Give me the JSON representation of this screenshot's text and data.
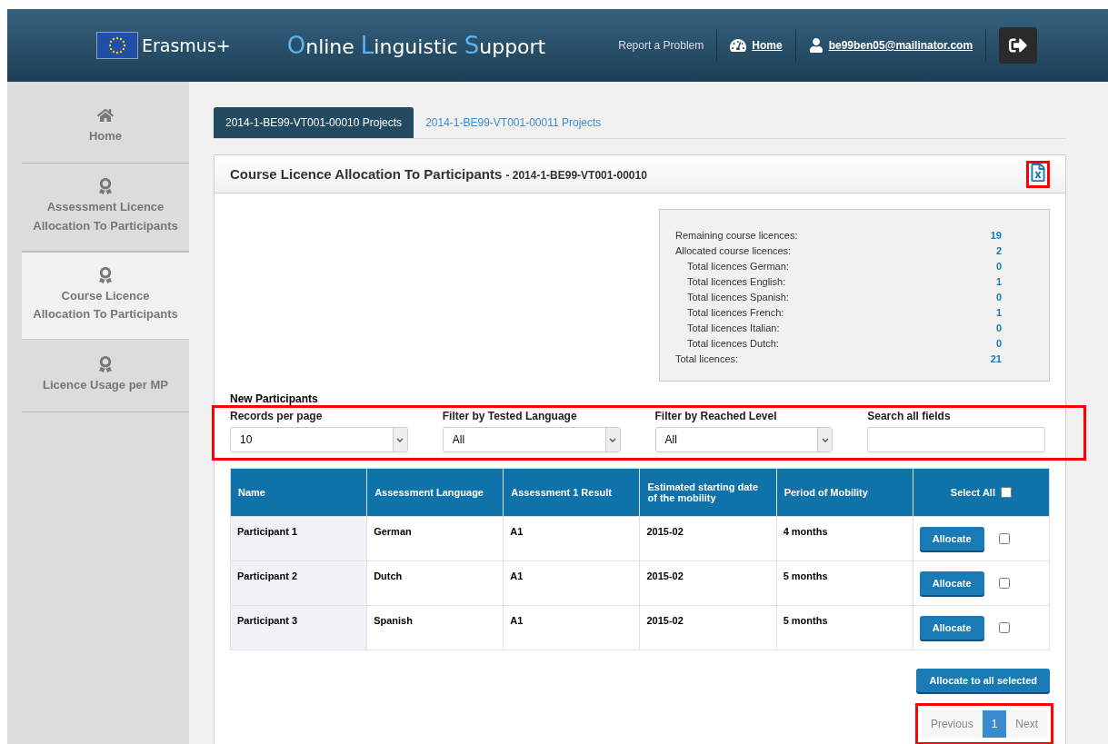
{
  "header": {
    "program": "Erasmus+",
    "title_parts": [
      {
        "text": "O",
        "accent": true
      },
      {
        "text": "nline ",
        "accent": false
      },
      {
        "text": "L",
        "accent": true
      },
      {
        "text": "inguistic ",
        "accent": false
      },
      {
        "text": "S",
        "accent": true
      },
      {
        "text": "upport",
        "accent": false
      }
    ],
    "report": "Report a Problem",
    "home": "Home",
    "user": "be99ben05@mailinator.com"
  },
  "sidebar": {
    "items": [
      {
        "label": "Home",
        "kind": "home",
        "selected": false
      },
      {
        "label": "Assessment Licence Allocation To Participants",
        "kind": "award",
        "selected": false
      },
      {
        "label": "Course Licence Allocation To Participants",
        "kind": "award",
        "selected": true
      },
      {
        "label": "Licence Usage per MP",
        "kind": "award",
        "selected": false
      }
    ]
  },
  "tabs": [
    {
      "label": "2014-1-BE99-VT001-00010 Projects",
      "selected": true
    },
    {
      "label": "2014-1-BE99-VT001-00011 Projects",
      "selected": false
    }
  ],
  "panel": {
    "title": "Course Licence Allocation To Participants",
    "subtitle": "- 2014-1-BE99-VT001-00010",
    "export_highlighted": true
  },
  "stats": [
    {
      "label": "Remaining course licences:",
      "value": "19",
      "indented": false
    },
    {
      "label": "Allocated course licences:",
      "value": "2",
      "indented": false
    },
    {
      "label": "Total licences German:",
      "value": "0",
      "indented": true
    },
    {
      "label": "Total licences English:",
      "value": "1",
      "indented": true
    },
    {
      "label": "Total licences Spanish:",
      "value": "0",
      "indented": true
    },
    {
      "label": "Total licences French:",
      "value": "1",
      "indented": true
    },
    {
      "label": "Total licences Italian:",
      "value": "0",
      "indented": true
    },
    {
      "label": "Total licences Dutch:",
      "value": "0",
      "indented": true
    },
    {
      "label": "Total licences:",
      "value": "21",
      "indented": false
    }
  ],
  "section_title": "New Participants",
  "filters": {
    "highlighted": true,
    "items": [
      {
        "label": "Records per page",
        "kind": "select",
        "value": "10"
      },
      {
        "label": "Filter by Tested Language",
        "kind": "select",
        "value": "All"
      },
      {
        "label": "Filter by Reached Level",
        "kind": "select",
        "value": "All"
      },
      {
        "label": "Search all fields",
        "kind": "text",
        "value": ""
      }
    ]
  },
  "table": {
    "columns": [
      "Name",
      "Assessment Language",
      "Assessment 1 Result",
      "Estimated starting date of the mobility",
      "Period of Mobility",
      "Select All"
    ],
    "select_all_checked": false,
    "rows": [
      {
        "cells": [
          "Participant 1",
          "German",
          "A1",
          "2015-02",
          "4 months"
        ],
        "action": "Allocate",
        "checked": false
      },
      {
        "cells": [
          "Participant 2",
          "Dutch",
          "A1",
          "2015-02",
          "5 months"
        ],
        "action": "Allocate",
        "checked": false
      },
      {
        "cells": [
          "Participant 3",
          "Spanish",
          "A1",
          "2015-02",
          "5 months"
        ],
        "action": "Allocate",
        "checked": false
      }
    ]
  },
  "allocate_all": "Allocate to all selected",
  "pagination": {
    "highlighted": true,
    "previous": "Previous",
    "pages": [
      {
        "label": "1",
        "selected": true
      }
    ],
    "next": "Next"
  }
}
